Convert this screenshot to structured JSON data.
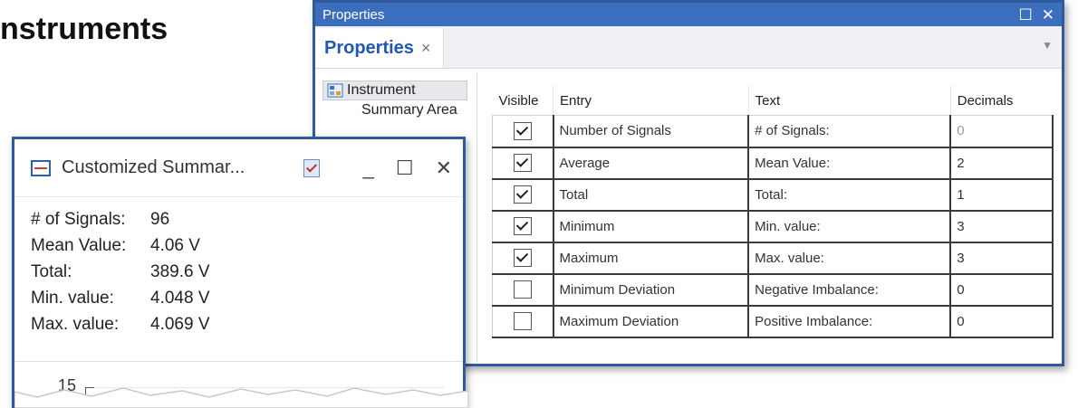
{
  "page": {
    "heading": "nstruments"
  },
  "properties_window": {
    "title": "Properties",
    "tab": {
      "label": "Properties",
      "close": "×"
    },
    "tree": [
      {
        "label": "Instrument",
        "selected": true
      },
      {
        "label": "Summary Area",
        "selected": false
      }
    ],
    "grid": {
      "headers": [
        "Visible",
        "Entry",
        "Text",
        "Decimals"
      ],
      "rows": [
        {
          "visible": true,
          "entry": "Number of Signals",
          "text": "# of Signals:",
          "decimals": "0",
          "decimals_dim": true
        },
        {
          "visible": true,
          "entry": "Average",
          "text": "Mean Value:",
          "decimals": "2"
        },
        {
          "visible": true,
          "entry": "Total",
          "text": "Total:",
          "decimals": "1"
        },
        {
          "visible": true,
          "entry": "Minimum",
          "text": "Min. value:",
          "decimals": "3"
        },
        {
          "visible": true,
          "entry": "Maximum",
          "text": "Max. value:",
          "decimals": "3"
        },
        {
          "visible": false,
          "entry": "Minimum Deviation",
          "text": "Negative Imbalance:",
          "decimals": "0"
        },
        {
          "visible": false,
          "entry": "Maximum Deviation",
          "text": "Positive Imbalance:",
          "decimals": "0"
        }
      ]
    }
  },
  "summary_window": {
    "title": "Customized Summar...",
    "stats": [
      {
        "label": "# of Signals:",
        "value": "96"
      },
      {
        "label": "Mean Value:",
        "value": "4.06 V"
      },
      {
        "label": "Total:",
        "value": "389.6 V"
      },
      {
        "label": "Min. value:",
        "value": "4.048 V"
      },
      {
        "label": "Max. value:",
        "value": "4.069 V"
      }
    ],
    "axis_tick": "15"
  },
  "colors": {
    "accent": "#3b6fbd",
    "tab_label": "#2059b3"
  }
}
